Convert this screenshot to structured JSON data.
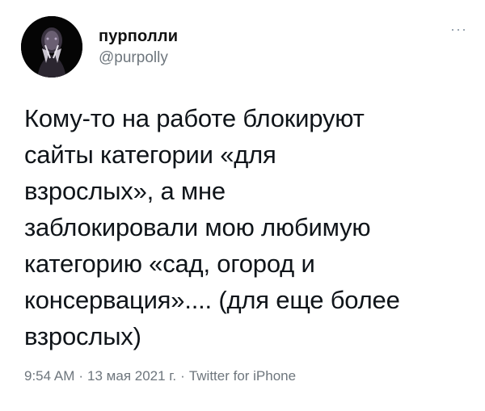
{
  "tweet": {
    "author": {
      "display_name": "пурполли",
      "handle": "@purpolly"
    },
    "more_label": "···",
    "text": "Кому-то на работе блокируют\nсайты категории «для\nвзрослых», а мне\nзаблокировали мою любимую\nкатегорию «сад, огород и\nконсервация».... (для еще более\nвзрослых)",
    "time": "9:54 AM",
    "separator": "·",
    "date": "13 мая 2021 г.",
    "source": "Twitter for iPhone"
  },
  "colors": {
    "text": "#0f1419",
    "secondary": "#6e767d",
    "background": "#ffffff"
  },
  "icons": {
    "more": "more-horizontal-icon",
    "avatar": "user-avatar"
  }
}
